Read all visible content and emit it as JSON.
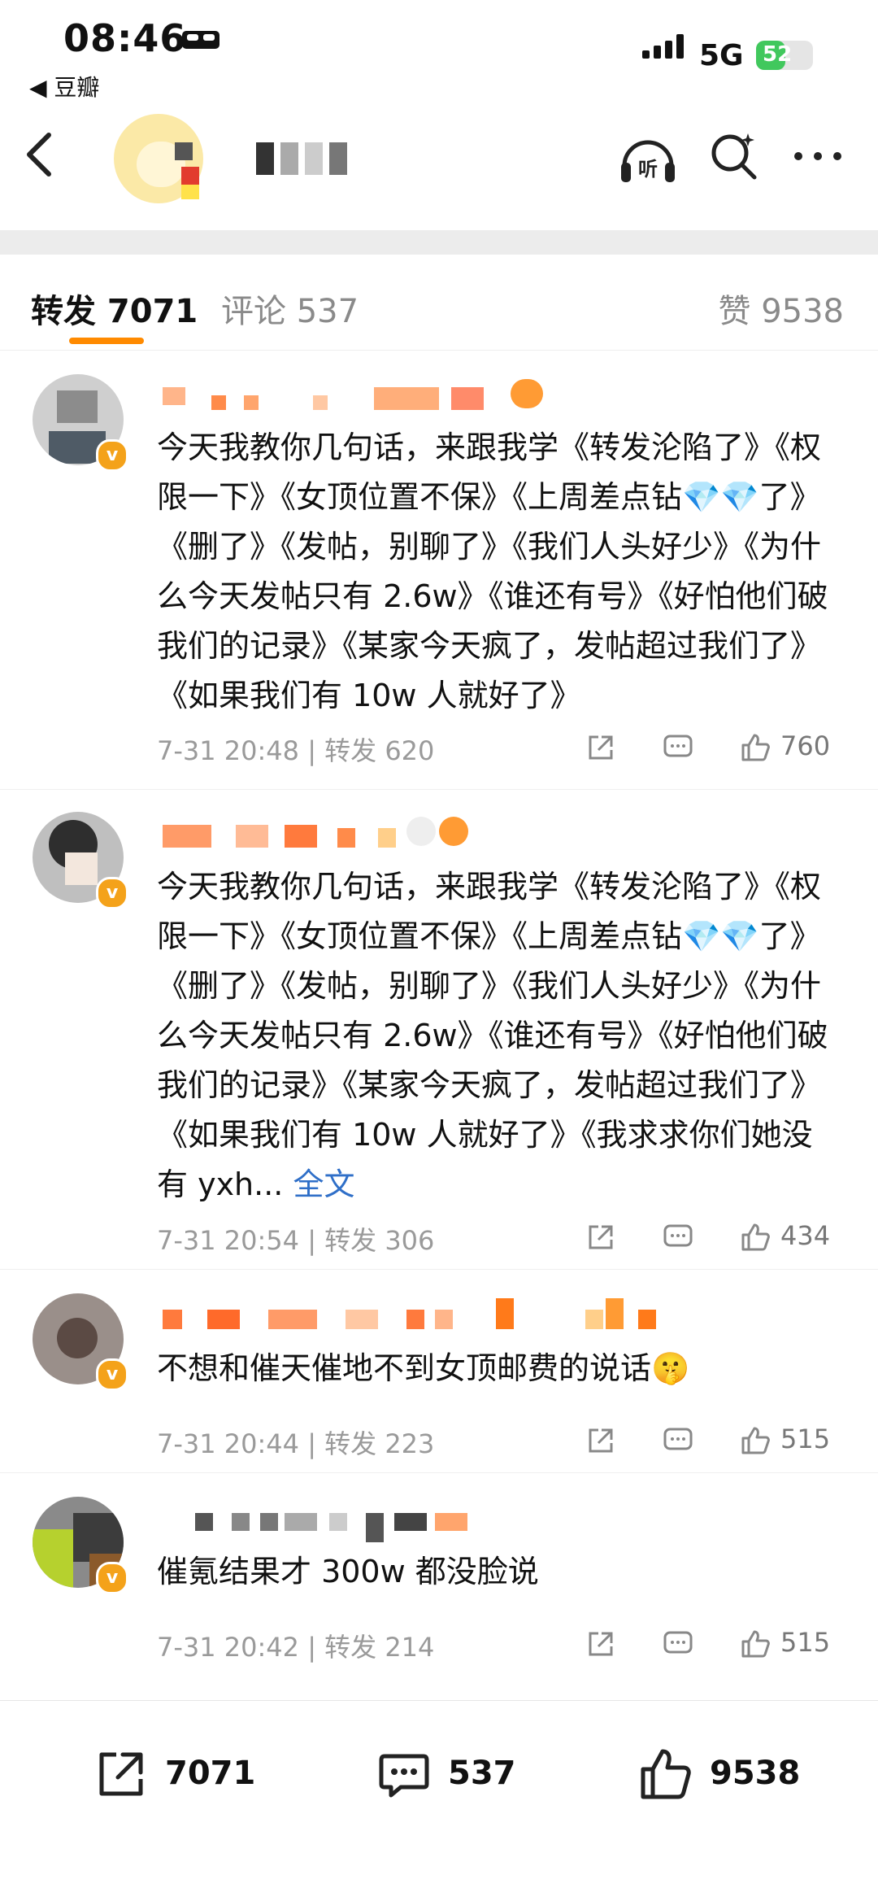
{
  "status_bar": {
    "time": "08:46",
    "back_app": "◀ 豆瓣",
    "network": "5G",
    "battery": "52",
    "battery_level": 0.52
  },
  "tabs": {
    "forward": "转发 7071",
    "comment": "评论 537",
    "like": "赞 9538"
  },
  "comments": [
    {
      "text": "今天我教你几句话，来跟我学《转发沦陷了》《权限一下》《女顶位置不保》《上周差点钻💎💎了》《删了》《发帖，别聊了》《我们人头好少》《为什么今天发帖只有 2.6w》《谁还有号》《好怕他们破我们的记录》《某家今天疯了，发帖超过我们了》《如果我们有 10w 人就好了》",
      "meta": "7-31 20:48 | 转发 620",
      "likes": "760"
    },
    {
      "text": "今天我教你几句话，来跟我学《转发沦陷了》《权限一下》《女顶位置不保》《上周差点钻💎💎了》《删了》《发帖，别聊了》《我们人头好少》《为什么今天发帖只有 2.6w》《谁还有号》《好怕他们破我们的记录》《某家今天疯了，发帖超过我们了》《如果我们有 10w 人就好了》《我求求你们她没有 yxh...",
      "full_label": "全文",
      "meta": "7-31 20:54 | 转发 306",
      "likes": "434"
    },
    {
      "text": "不想和催天催地不到女顶邮费的说话🤫",
      "meta": "7-31 20:44 | 转发 223",
      "likes": "515"
    },
    {
      "text": "催氪结果才 300w 都没脸说",
      "meta": "7-31 20:42 | 转发 214",
      "likes": "515"
    }
  ],
  "bottom_bar": {
    "forward": "7071",
    "comment": "537",
    "like": "9538"
  },
  "icons": [
    "back-arrow-icon",
    "listen-icon",
    "search-icon",
    "more-icon",
    "share-icon",
    "comment-icon",
    "like-icon"
  ],
  "colors": {
    "accent": "#ff8a00",
    "badge": "#f4a21a",
    "link": "#2f6fc8",
    "battery": "#41c85d"
  }
}
